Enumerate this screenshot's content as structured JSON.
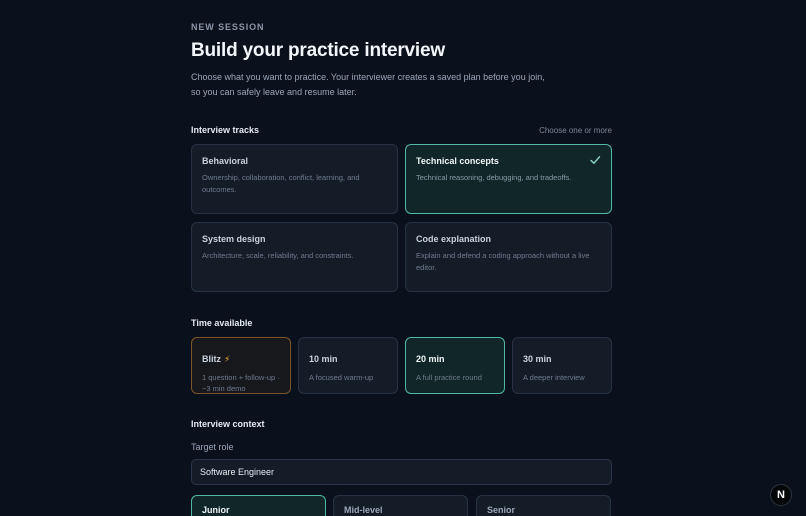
{
  "header": {
    "eyebrow": "NEW SESSION",
    "title": "Build your practice interview",
    "description_line1": "Choose what you want to practice. Your interviewer creates a saved plan before you join,",
    "description_line2": "so you can safely leave and resume later."
  },
  "tracks": {
    "title": "Interview tracks",
    "hint": "Choose one or more",
    "items": [
      {
        "title": "Behavioral",
        "description": "Ownership, collaboration, conflict, learning, and outcomes.",
        "selected": false
      },
      {
        "title": "Technical concepts",
        "description": "Technical reasoning, debugging, and tradeoffs.",
        "selected": true
      },
      {
        "title": "System design",
        "description": "Architecture, scale, reliability, and constraints.",
        "selected": false
      },
      {
        "title": "Code explanation",
        "description": "Explain and defend a coding approach without a live editor.",
        "selected": false
      }
    ]
  },
  "time": {
    "title": "Time available",
    "items": [
      {
        "title": "Blitz",
        "icon": "lightning-icon",
        "description": "1 question + follow-up · ~3 min demo",
        "selected": false
      },
      {
        "title": "10 min",
        "description": "A focused warm-up",
        "selected": false
      },
      {
        "title": "20 min",
        "description": "A full practice round",
        "selected": true
      },
      {
        "title": "30 min",
        "description": "A deeper interview",
        "selected": false
      }
    ]
  },
  "context": {
    "title": "Interview context",
    "target_role_label": "Target role",
    "target_role_value": "Software Engineer",
    "levels": [
      {
        "label": "Junior",
        "selected": true
      },
      {
        "label": "Mid-level",
        "selected": false
      },
      {
        "label": "Senior",
        "selected": false
      }
    ]
  },
  "badge": {
    "letter": "N"
  },
  "colors": {
    "accent": "#4fb8a6",
    "background": "#0b111c",
    "card": "#141c28",
    "blitz_border": "#7a5528"
  }
}
